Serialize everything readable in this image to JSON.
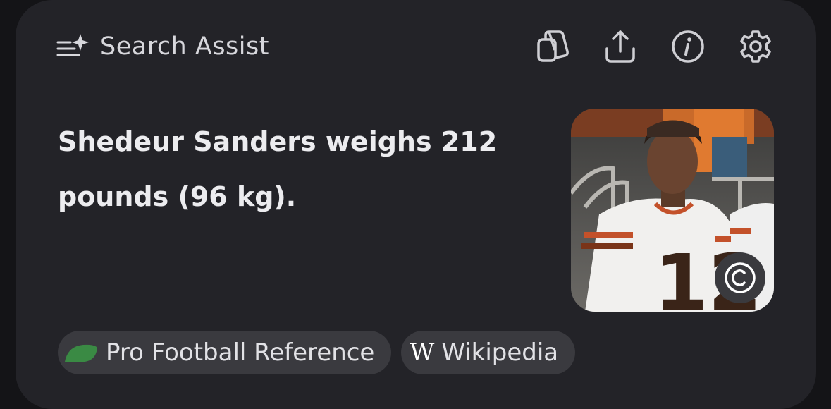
{
  "header": {
    "title": "Search Assist",
    "icon": "sparkle-lines-icon"
  },
  "actions": [
    {
      "name": "copy-button",
      "icon": "copy-icon"
    },
    {
      "name": "share-button",
      "icon": "share-icon"
    },
    {
      "name": "info-button",
      "icon": "info-icon"
    },
    {
      "name": "settings-button",
      "icon": "gear-icon"
    }
  ],
  "answer": {
    "text": "Shedeur Sanders weighs 212 pounds (96 kg)."
  },
  "photo": {
    "jersey_number": "12",
    "badge_icon": "copyright-icon",
    "badge_text": "©"
  },
  "sources": [
    {
      "label": "Pro Football Reference",
      "icon": "pfr-logo-icon",
      "color": "#3a8a44"
    },
    {
      "label": "Wikipedia",
      "icon": "wikipedia-icon",
      "glyph": "W"
    }
  ],
  "colors": {
    "background": "#141417",
    "card": "#232328",
    "chip": "#3a3a3f",
    "text": "#ececef"
  }
}
